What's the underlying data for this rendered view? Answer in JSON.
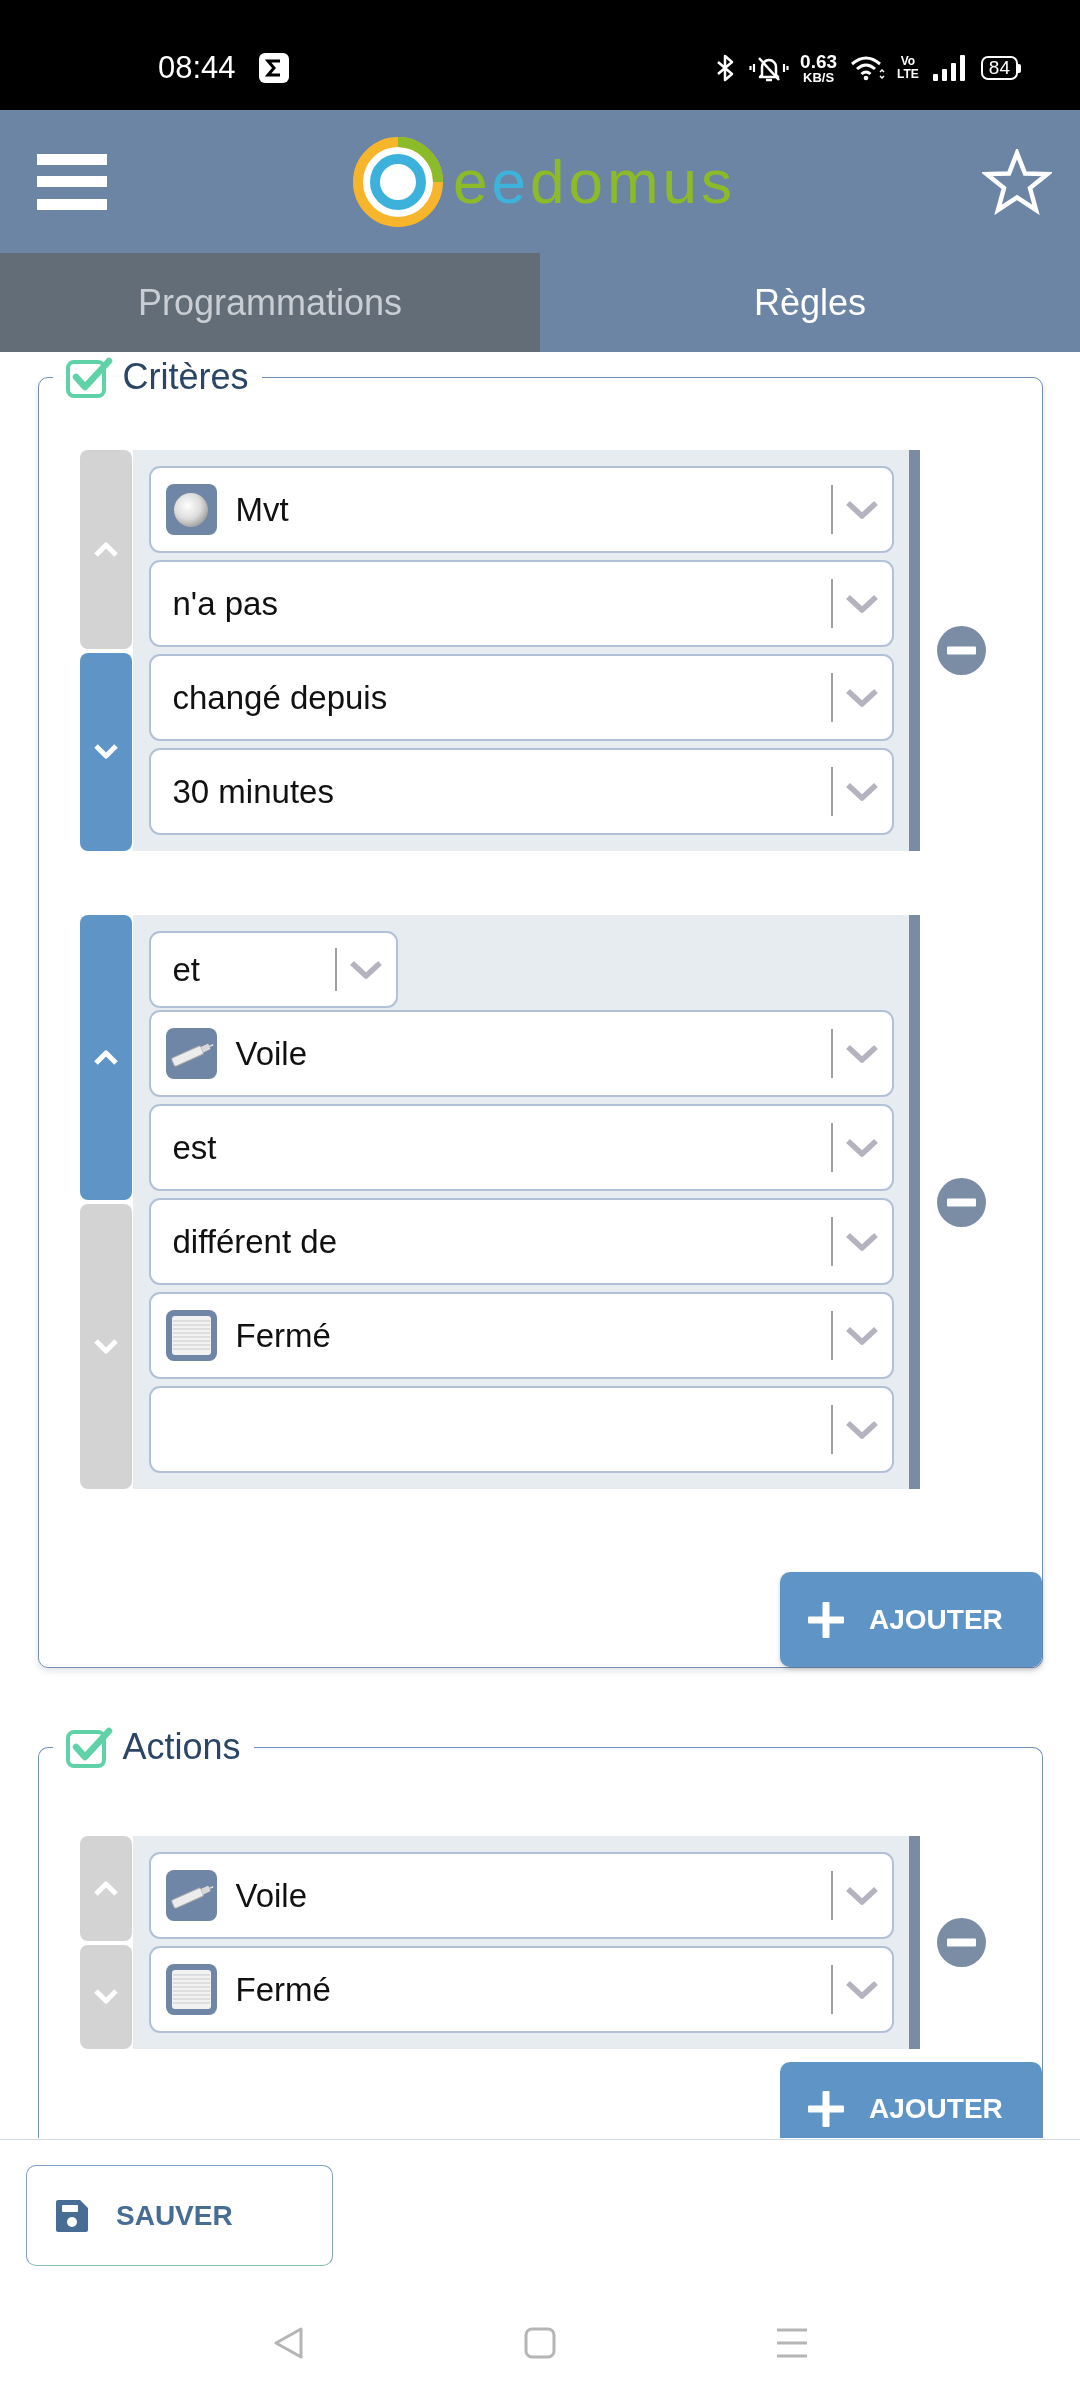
{
  "status_bar": {
    "time": "08:44",
    "data_rate": "0.63",
    "data_rate_unit": "KB/S",
    "network": "Vo LTE",
    "battery": "84"
  },
  "header": {
    "logo_text": "eedomus"
  },
  "tabs": [
    {
      "label": "Programmations",
      "selected": false
    },
    {
      "label": "Règles",
      "selected": true
    }
  ],
  "sections": [
    {
      "title": "Critères",
      "checked": true,
      "rules": [
        {
          "up_disabled": true,
          "down_disabled": false,
          "fields": [
            {
              "kind": "sensor",
              "value": "Mvt"
            },
            {
              "kind": "text",
              "value": "n'a pas"
            },
            {
              "kind": "text",
              "value": "changé depuis"
            },
            {
              "kind": "text",
              "value": "30 minutes"
            }
          ]
        },
        {
          "connector": "et",
          "up_disabled": false,
          "down_disabled": true,
          "fields": [
            {
              "kind": "actuator",
              "value": "Voile"
            },
            {
              "kind": "text",
              "value": "est"
            },
            {
              "kind": "text",
              "value": "différent de"
            },
            {
              "kind": "state",
              "value": "Fermé"
            },
            {
              "kind": "text"
            }
          ]
        }
      ],
      "add_button": "AJOUTER"
    },
    {
      "title": "Actions",
      "checked": true,
      "rules": [
        {
          "up_disabled": true,
          "down_disabled": true,
          "fields": [
            {
              "kind": "actuator",
              "value": "Voile"
            },
            {
              "kind": "state",
              "value": "Fermé"
            }
          ]
        }
      ],
      "add_button": "AJOUTER"
    }
  ],
  "save_button": "SAUVER"
}
